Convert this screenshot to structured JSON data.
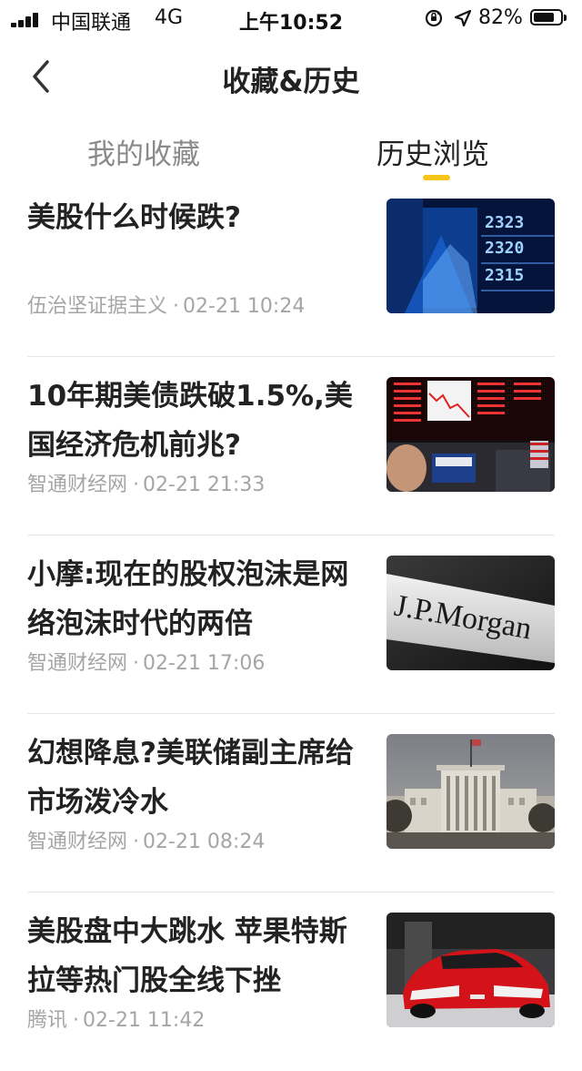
{
  "status_bar": {
    "carrier": "中国联通",
    "network": "4G",
    "time": "上午10:52",
    "battery": "82%",
    "battery_level": 0.82,
    "icons": [
      "signal-icon",
      "orientation-lock-icon",
      "location-icon",
      "battery-icon"
    ]
  },
  "nav": {
    "title": "收藏&历史",
    "back_icon": "chevron-left-icon"
  },
  "tabs": [
    {
      "label": "我的收藏",
      "active": false
    },
    {
      "label": "历史浏览",
      "active": true
    }
  ],
  "colors": {
    "accent": "#f5c518",
    "meta_text": "#a5a5a5",
    "inactive_tab": "#8a8a8a"
  },
  "articles": [
    {
      "title": "美股什么时候跌?",
      "source": "伍治坚证据主义",
      "time": "02-21 10:24",
      "thumbnail": "stock-ticker-board-image"
    },
    {
      "title": "10年期美债跌破1.5%,美国经济危机前兆?",
      "source": "智通财经网",
      "time": "02-21 21:33",
      "thumbnail": "stock-exchange-screens-image"
    },
    {
      "title": "小摩:现在的股权泡沫是网络泡沫时代的两倍",
      "source": "智通财经网",
      "time": "02-21 17:06",
      "thumbnail": "jp-morgan-sign-image",
      "thumbnail_text": "J.P.Morgan"
    },
    {
      "title": "幻想降息?美联储副主席给市场泼冷水",
      "source": "智通财经网",
      "time": "02-21 08:24",
      "thumbnail": "federal-reserve-building-image"
    },
    {
      "title": "美股盘中大跳水 苹果特斯拉等热门股全线下挫",
      "source": "腾讯",
      "time": "02-21 11:42",
      "thumbnail": "red-tesla-car-image"
    }
  ]
}
